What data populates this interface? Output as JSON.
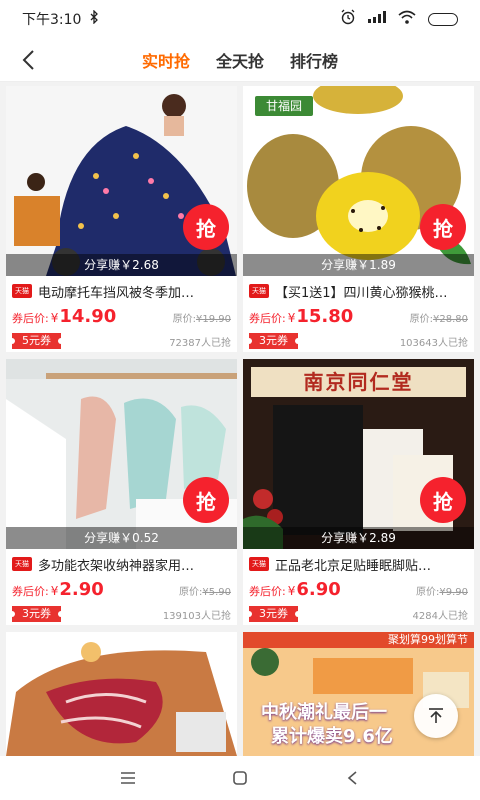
{
  "status": {
    "time": "下午3:10"
  },
  "header": {
    "tabs": [
      {
        "label": "实时抢"
      },
      {
        "label": "全天抢"
      },
      {
        "label": "排行榜"
      }
    ]
  },
  "products": [
    {
      "title": "电动摩托车挡风被冬季加…",
      "share": "分享赚￥2.68",
      "price_label": "券后价:",
      "yen": "¥",
      "price": "14.90",
      "orig_label": "原价:",
      "orig_price": "¥19.90",
      "coupon": "5元券",
      "sold": "72387人已抢",
      "grab": "抢",
      "badge": "天猫"
    },
    {
      "title": "【买1送1】四川黄心猕猴桃…",
      "share": "分享赚￥1.89",
      "price_label": "券后价:",
      "yen": "¥",
      "price": "15.80",
      "orig_label": "原价:",
      "orig_price": "¥28.80",
      "coupon": "3元券",
      "sold": "103643人已抢",
      "grab": "抢",
      "badge": "天猫",
      "brand": "甘福园"
    },
    {
      "title": "多功能衣架收纳神器家用…",
      "share": "分享赚￥0.52",
      "price_label": "券后价:",
      "yen": "¥",
      "price": "2.90",
      "orig_label": "原价:",
      "orig_price": "¥5.90",
      "coupon": "3元券",
      "sold": "139103人已抢",
      "grab": "抢",
      "badge": "天猫"
    },
    {
      "title": "正品老北京足贴睡眠脚贴…",
      "share": "分享赚￥2.89",
      "price_label": "券后价:",
      "yen": "¥",
      "price": "6.90",
      "orig_label": "原价:",
      "orig_price": "¥9.90",
      "coupon": "3元券",
      "sold": "4284人已抢",
      "grab": "抢",
      "badge": "天猫",
      "brand": "南京同仁堂"
    },
    {
      "title": "",
      "badge": ""
    },
    {
      "title": "",
      "banner_top": "聚划算99划算节",
      "banner_line1": "中秋潮礼最后一",
      "banner_line2": "累计爆卖9.6亿"
    }
  ],
  "colors": {
    "accent": "#ff6a00",
    "price": "#f5222d"
  }
}
